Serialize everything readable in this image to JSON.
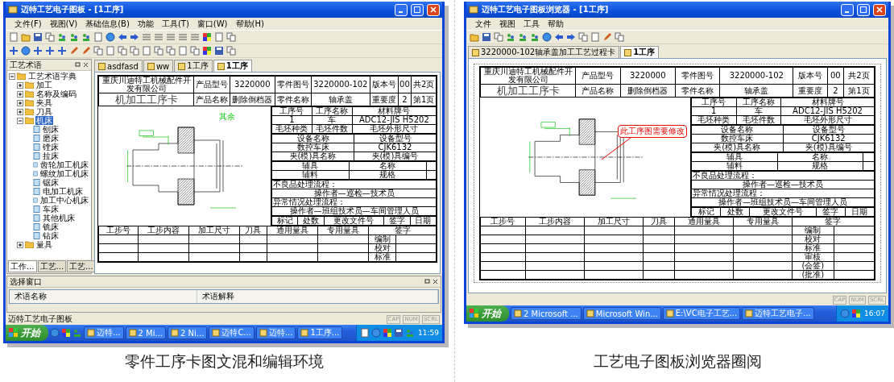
{
  "left_window": {
    "title": "迈特工艺电子图板 - [1工序]",
    "menu": [
      "文件(F)",
      "视图(V)",
      "基础信息(B)",
      "功能",
      "工具(T)",
      "窗口(W)",
      "帮助(H)"
    ],
    "side_panel": {
      "title": "工艺术语",
      "tree": [
        {
          "label": "工艺术语字典",
          "expanded": true,
          "selected": false,
          "children": [
            {
              "label": "加工",
              "expanded": false,
              "selected": false
            },
            {
              "label": "名称及编码",
              "expanded": false,
              "selected": false
            },
            {
              "label": "夹具",
              "expanded": false,
              "selected": false
            },
            {
              "label": "刀具",
              "expanded": false,
              "selected": false
            },
            {
              "label": "机床",
              "expanded": true,
              "selected": true,
              "children": [
                {
                  "label": "刨床",
                  "selected": false
                },
                {
                  "label": "磨床",
                  "selected": false
                },
                {
                  "label": "镗床",
                  "selected": false
                },
                {
                  "label": "拉床",
                  "selected": false
                },
                {
                  "label": "齿轮加工机床",
                  "selected": false
                },
                {
                  "label": "螺纹加工机床",
                  "selected": false
                },
                {
                  "label": "锯床",
                  "selected": false
                },
                {
                  "label": "电加工机床",
                  "selected": false
                },
                {
                  "label": "加工中心机床",
                  "selected": false
                },
                {
                  "label": "车床",
                  "selected": false
                },
                {
                  "label": "其他机床",
                  "selected": false
                },
                {
                  "label": "铣床",
                  "selected": false
                },
                {
                  "label": "钻床",
                  "selected": false
                }
              ]
            },
            {
              "label": "量具",
              "expanded": false,
              "selected": false
            }
          ]
        }
      ],
      "tabs": [
        {
          "label": "工作...",
          "selected": true
        },
        {
          "label": "工艺...",
          "selected": false
        },
        {
          "label": "工艺...",
          "selected": false
        }
      ]
    },
    "doc_tabs": [
      {
        "label": "asdfasd",
        "selected": false
      },
      {
        "label": "ww",
        "selected": false
      },
      {
        "label": "1工序",
        "selected": false
      },
      {
        "label": "1工序",
        "selected": true
      }
    ],
    "card": {
      "company": "重庆川迪特工机械配件开发有限公司",
      "title": "机加工工序卡",
      "header_rows": [
        [
          {
            "label": "产品型号",
            "value": "3220000"
          },
          {
            "label": "零件图号",
            "value": "3220000-102"
          },
          {
            "label": "版本号",
            "value": "00"
          }
        ],
        [
          {
            "label": "产品名称",
            "value": "删除倒档器"
          },
          {
            "label": "零件名称",
            "value": "轴承盖"
          },
          {
            "label": "重要度",
            "value": "2"
          }
        ]
      ],
      "pages": [
        "共2页",
        "第1页"
      ],
      "drawing_note": "其余",
      "operation": [
        [
          "工序号",
          "工序名称",
          "材料牌号"
        ],
        [
          "1",
          "车",
          "ADC12-JIS H5202"
        ],
        [
          "毛坯种类",
          "毛坯件数",
          "毛坯外形尺寸"
        ]
      ],
      "equipment": [
        [
          "设备名称",
          "设备型号"
        ],
        [
          "数控车床",
          "CJK6132"
        ],
        [
          "夹(模)具名称",
          "夹(模)具编号"
        ]
      ],
      "aids": [
        [
          "辅具",
          "名称"
        ],
        [
          "辅料",
          "规格"
        ]
      ],
      "notes": [
        "不良品处理流程：",
        "操作者—巡检—技术员",
        "异常情况处理流程：",
        "操作者—班组技术员—车间管理人员"
      ],
      "revision": [
        "标记",
        "处数",
        "更改文件号",
        "签字",
        "日期"
      ],
      "steps_header": [
        "工步号",
        "工步内容",
        "加工尺寸",
        "刀具",
        "通用量具",
        "专用量具",
        "签字"
      ],
      "sign_rows": [
        "编制",
        "校对",
        "标准"
      ]
    },
    "bottom_panel": {
      "title": "选择窗口",
      "columns": [
        "术语名称",
        "术语解释"
      ]
    },
    "status_bar": {
      "text": "迈特工艺电子图板",
      "indicators": [
        "CAP",
        "NUM",
        "SCRL"
      ]
    },
    "taskbar": {
      "start": "开始",
      "items": [
        "迈特...",
        "2 Mi...",
        "2 Ni...",
        "迈特C...",
        "迈特...",
        "1工序..."
      ],
      "clock": "11:59"
    }
  },
  "left_caption": "零件工序卡图文混和编辑环境",
  "right_window": {
    "title": "迈特工艺电子图板浏览器 - [1工序]",
    "menu": [
      "文件",
      "视图",
      "工具",
      "帮助"
    ],
    "doc_tabs": [
      {
        "label": "3220000-102轴承盖加工工艺过程卡",
        "selected": false
      },
      {
        "label": "1工序",
        "selected": true
      }
    ],
    "card": {
      "company": "重庆川迪特工机械配件开发有限公司",
      "title": "机加工工序卡",
      "header_rows": [
        [
          {
            "label": "产品型号",
            "value": "3220000"
          },
          {
            "label": "零件图号",
            "value": "3220000-102"
          },
          {
            "label": "版本号",
            "value": "00"
          }
        ],
        [
          {
            "label": "产品名称",
            "value": "删除倒档器"
          },
          {
            "label": "零件名称",
            "value": "轴承盖"
          },
          {
            "label": "重要度",
            "value": "2"
          }
        ]
      ],
      "pages": [
        "共2页",
        "第1页"
      ],
      "annotation": "此工序图需要修改",
      "operation": [
        [
          "工序号",
          "工序名称",
          "材料牌号"
        ],
        [
          "1",
          "车",
          "ADC12-JIS H5202"
        ],
        [
          "毛坯种类",
          "毛坯件数",
          "毛坯外形尺寸"
        ]
      ],
      "equipment": [
        [
          "设备名称",
          "设备型号"
        ],
        [
          "数控车床",
          "CJK6132"
        ],
        [
          "夹(模)具名称",
          "夹(模)具编号"
        ]
      ],
      "aids": [
        [
          "辅具",
          "名称"
        ],
        [
          "辅料",
          "规格"
        ]
      ],
      "notes": [
        "不良品处理流程：",
        "操作者—巡检—技术员",
        "异常情况处理流程：",
        "操作者—班组技术员—车间管理人员"
      ],
      "revision": [
        "标记",
        "处数",
        "更改文件号",
        "签字",
        "日期"
      ],
      "steps_header": [
        "工步号",
        "工步内容",
        "加工尺寸",
        "刀具",
        "通用量具",
        "专用量具",
        "签字"
      ],
      "sign_rows": [
        "编制",
        "校对",
        "标准",
        "审核",
        "(会签)",
        "(批准)"
      ]
    },
    "status_bar": {
      "indicators": [
        "CAP",
        "NUM",
        "SCRL"
      ]
    },
    "taskbar": {
      "start": "开始",
      "items": [
        "2 Microsoft ...",
        "Microsoft Win...",
        "E:\\VC电子工艺...",
        "迈特工艺电子..."
      ],
      "clock": "16:07"
    }
  },
  "right_caption": "工艺电子图板浏览器圈阅"
}
